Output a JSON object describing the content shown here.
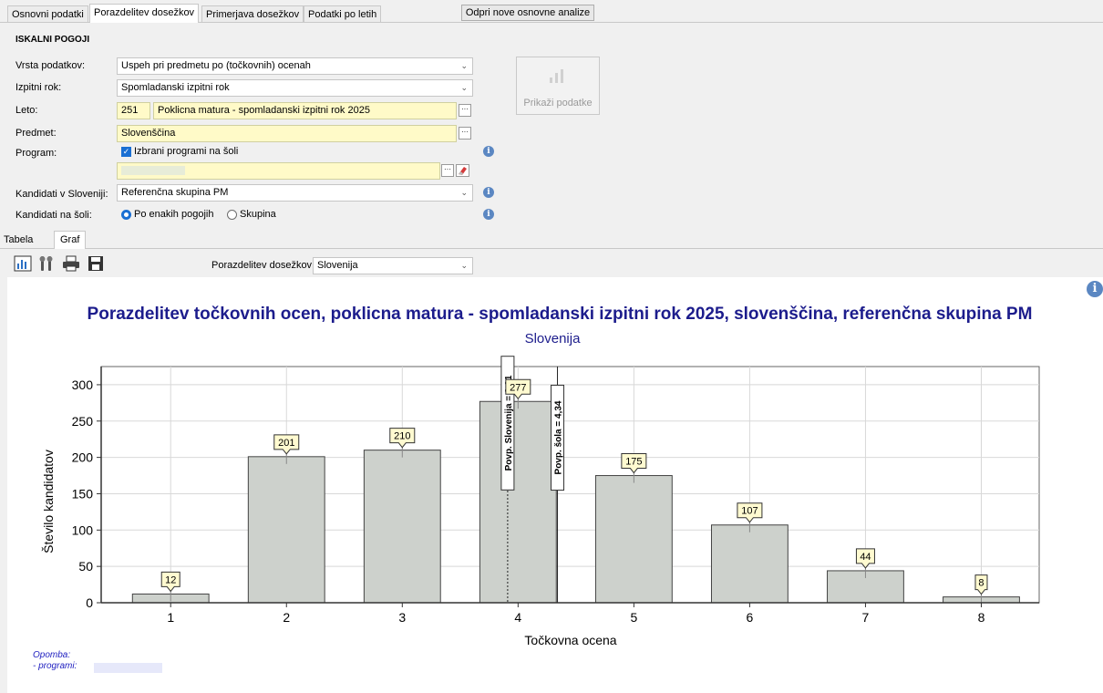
{
  "tabs": [
    "Osnovni podatki",
    "Porazdelitev dosežkov",
    "Primerjava dosežkov",
    "Podatki po letih"
  ],
  "open_analysis_button": "Odpri nove osnovne analize",
  "search": {
    "section_title": "ISKALNI POGOJI",
    "vrsta_label": "Vrsta podatkov:",
    "vrsta_value": "Uspeh pri predmetu po (točkovnih) ocenah",
    "rok_label": "Izpitni rok:",
    "rok_value": "Spomladanski izpitni rok",
    "leto_label": "Leto:",
    "leto_code": "251",
    "leto_value": "Poklicna matura - spomladanski izpitni rok 2025",
    "predmet_label": "Predmet:",
    "predmet_value": "Slovenščina",
    "program_label": "Program:",
    "program_checkbox": "Izbrani programi na šoli",
    "kandidati_slo_label": "Kandidati v Sloveniji:",
    "kandidati_slo_value": "Referenčna skupina PM",
    "kandidati_sola_label": "Kandidati na šoli:",
    "radio_enaki": "Po enakih pogojih",
    "radio_skupina": "Skupina",
    "show_button": "Prikaži podatke"
  },
  "subtabs": [
    "Tabela",
    "Graf"
  ],
  "toolbar": {
    "dist_label": "Porazdelitev dosežkov:",
    "dist_value": "Slovenija"
  },
  "note": {
    "title": "Opomba:",
    "programs": "- programi:"
  },
  "colors": {
    "bar": "#cdd1cc",
    "title": "#1c1c8c",
    "accent": "#1a6fd3"
  },
  "chart_data": {
    "type": "bar",
    "title": "Porazdelitev točkovnih ocen, poklicna matura - spomladanski izpitni rok 2025, slovenščina, referenčna skupina PM",
    "subtitle": "Slovenija",
    "xlabel": "Točkovna ocena",
    "ylabel": "Število kandidatov",
    "categories": [
      "1",
      "2",
      "3",
      "4",
      "5",
      "6",
      "7",
      "8"
    ],
    "values": [
      12,
      201,
      210,
      277,
      175,
      107,
      44,
      8
    ],
    "ylim": [
      0,
      325
    ],
    "yticks": [
      0,
      50,
      100,
      150,
      200,
      250,
      300
    ],
    "grid": true,
    "reference_lines": [
      {
        "label": "Povp. Slovenija = 3,91",
        "x": 3.91,
        "style": "dotted"
      },
      {
        "label": "Povp. šola = 4,34",
        "x": 4.34,
        "style": "solid"
      }
    ]
  }
}
